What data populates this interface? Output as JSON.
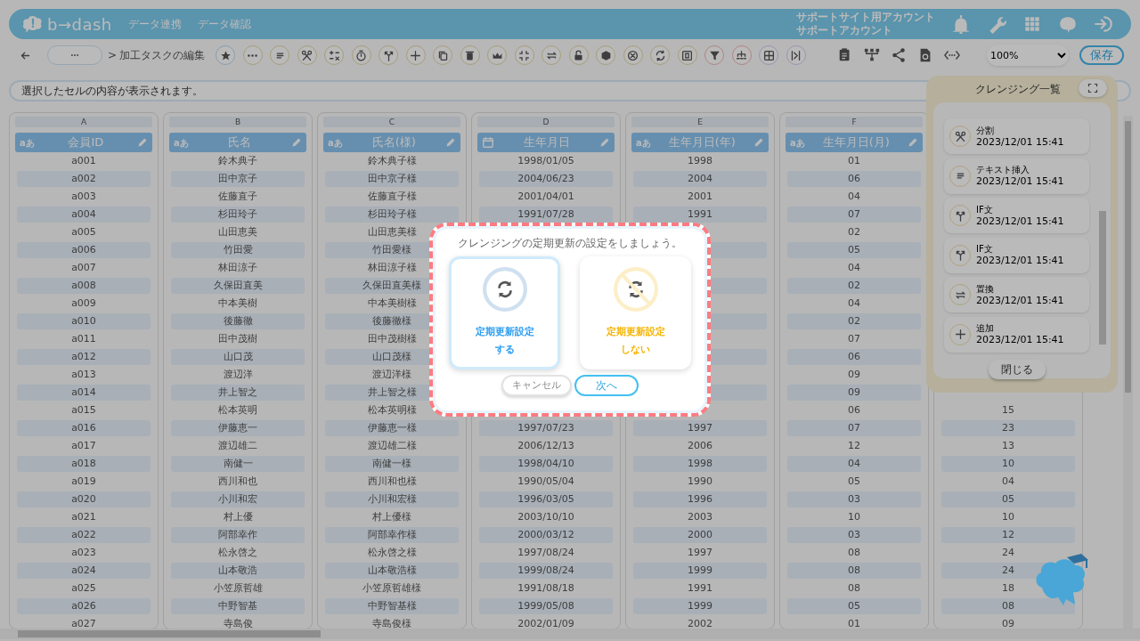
{
  "header": {
    "logo": "b→dash",
    "nav": [
      {
        "label": "データ連携"
      },
      {
        "label": "データ確認"
      }
    ],
    "account": [
      "サポートサイト用アカウント",
      "サポートアカウント"
    ]
  },
  "toolbar": {
    "breadcrumb_sep": ">",
    "breadcrumb": "加工タスクの編集",
    "zoom": "100%",
    "save": "保存"
  },
  "cell_display": {
    "placeholder": "選択したセルの内容が表示されます。"
  },
  "table": {
    "columns": [
      {
        "letter": "A",
        "name": "会員ID",
        "kind": "text",
        "type_label": "aあ"
      },
      {
        "letter": "B",
        "name": "氏名",
        "kind": "text",
        "type_label": "aあ"
      },
      {
        "letter": "C",
        "name": "氏名(様)",
        "kind": "text",
        "type_label": "aあ"
      },
      {
        "letter": "D",
        "name": "生年月日",
        "kind": "date"
      },
      {
        "letter": "E",
        "name": "生年月日(年)",
        "kind": "text",
        "type_label": "aあ"
      },
      {
        "letter": "F",
        "name": "生年月日(月)",
        "kind": "text",
        "type_label": "aあ"
      },
      {
        "kind": "text"
      }
    ],
    "rows": [
      [
        "a001",
        "鈴木典子",
        "鈴木典子様",
        "1998/01/05",
        "1998",
        "01",
        null
      ],
      [
        "a002",
        "田中京子",
        "田中京子様",
        "2004/06/23",
        "2004",
        "06",
        null
      ],
      [
        "a003",
        "佐藤直子",
        "佐藤直子様",
        "2001/04/01",
        "2001",
        "04",
        null
      ],
      [
        "a004",
        "杉田玲子",
        "杉田玲子様",
        "1991/07/28",
        "1991",
        "07",
        null
      ],
      [
        "a005",
        "山田恵美",
        "山田恵美様",
        null,
        null,
        "02",
        null
      ],
      [
        "a006",
        "竹田愛",
        "竹田愛様",
        null,
        null,
        "05",
        null
      ],
      [
        "a007",
        "林田涼子",
        "林田涼子様",
        null,
        null,
        "04",
        null
      ],
      [
        "a008",
        "久保田直美",
        "久保田直美様",
        null,
        null,
        "02",
        null
      ],
      [
        "a009",
        "中本美樹",
        "中本美樹様",
        null,
        null,
        "04",
        null
      ],
      [
        "a010",
        "後藤徹",
        "後藤徹様",
        null,
        null,
        "02",
        null
      ],
      [
        "a011",
        "田中茂樹",
        "田中茂樹様",
        null,
        null,
        "07",
        null
      ],
      [
        "a012",
        "山口茂",
        "山口茂様",
        null,
        null,
        "06",
        null
      ],
      [
        "a013",
        "渡辺洋",
        "渡辺洋様",
        null,
        null,
        "09",
        null
      ],
      [
        "a014",
        "井上智之",
        "井上智之様",
        null,
        null,
        "09",
        null
      ],
      [
        "a015",
        "松本英明",
        "松本英明様",
        null,
        null,
        "06",
        "15"
      ],
      [
        "a016",
        "伊藤恵一",
        "伊藤恵一様",
        "1997/07/23",
        "1997",
        "07",
        "23"
      ],
      [
        "a017",
        "渡辺雄二",
        "渡辺雄二様",
        "2006/12/13",
        "2006",
        "12",
        "13"
      ],
      [
        "a018",
        "南健一",
        "南健一様",
        "1998/04/10",
        "1998",
        "04",
        "10"
      ],
      [
        "a019",
        "西川和也",
        "西川和也様",
        "1990/05/04",
        "1990",
        "05",
        "04"
      ],
      [
        "a020",
        "小川和宏",
        "小川和宏様",
        "1996/03/05",
        "1996",
        "03",
        "05"
      ],
      [
        "a021",
        "村上優",
        "村上優様",
        "2003/10/10",
        "2003",
        "10",
        "10"
      ],
      [
        "a022",
        "阿部幸作",
        "阿部幸作様",
        "2000/03/12",
        "2000",
        "03",
        "12"
      ],
      [
        "a023",
        "松永啓之",
        "松永啓之様",
        "1997/08/24",
        "1997",
        "08",
        "24"
      ],
      [
        "a024",
        "山本敬浩",
        "山本敬浩様",
        "1999/08/24",
        "1999",
        "08",
        "24"
      ],
      [
        "a025",
        "小笠原哲雄",
        "小笠原哲雄様",
        "1991/08/18",
        "1991",
        "08",
        "18"
      ],
      [
        "a026",
        "中野智基",
        "中野智基様",
        "1999/05/08",
        "1999",
        "05",
        "08"
      ],
      [
        "a027",
        "寺島俊",
        "寺島俊様",
        "2002/01/09",
        "2002",
        "01",
        "09"
      ]
    ]
  },
  "cleansing_panel": {
    "title": "クレンジング一覧",
    "items": [
      {
        "kind": "split",
        "name": "分割",
        "time": "2023/12/01 15:41"
      },
      {
        "kind": "text",
        "name": "テキスト挿入",
        "time": "2023/12/01 15:41"
      },
      {
        "kind": "if",
        "name": "IF文",
        "time": "2023/12/01 15:41"
      },
      {
        "kind": "if",
        "name": "IF文",
        "time": "2023/12/01 15:41"
      },
      {
        "kind": "replace",
        "name": "置換",
        "time": "2023/12/01 15:41"
      },
      {
        "kind": "add",
        "name": "追加",
        "time": "2023/12/01 15:41"
      }
    ],
    "close": "閉じる"
  },
  "dialog": {
    "message": "クレンジングの定期更新の設定をしましょう。",
    "options": [
      {
        "kind": "enable",
        "label_lines": [
          "定期更新設定",
          "する"
        ],
        "selected": true
      },
      {
        "kind": "disable",
        "label_lines": [
          "定期更新設定",
          "しない"
        ],
        "selected": false
      }
    ],
    "buttons": [
      {
        "kind": "secondary",
        "label": "キャンセル"
      },
      {
        "kind": "primary",
        "label": "次へ"
      }
    ]
  }
}
